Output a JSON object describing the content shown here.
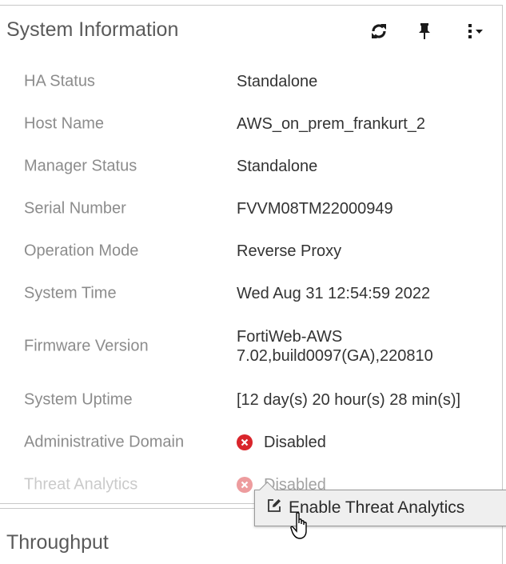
{
  "system_info": {
    "title": "System Information",
    "header_icons": [
      "refresh-icon",
      "pin-icon",
      "more-menu-icon"
    ],
    "rows": [
      {
        "label": "HA Status",
        "value": "Standalone"
      },
      {
        "label": "Host Name",
        "value": "AWS_on_prem_frankurt_2"
      },
      {
        "label": "Manager Status",
        "value": "Standalone"
      },
      {
        "label": "Serial Number",
        "value": "FVVM08TM22000949"
      },
      {
        "label": "Operation Mode",
        "value": "Reverse Proxy"
      },
      {
        "label": "System Time",
        "value": "Wed Aug 31 12:54:59 2022"
      },
      {
        "label": "Firmware Version",
        "value_line1": "FortiWeb-AWS",
        "value_line2": "7.02,build0097(GA),220810"
      },
      {
        "label": "System Uptime",
        "value": "[12 day(s) 20 hour(s) 28 min(s)]"
      },
      {
        "label": "Administrative Domain",
        "value": "Disabled",
        "icon": "disabled-x-icon",
        "icon_color": "#d9252b"
      },
      {
        "label": "Threat Analytics",
        "value": "Disabled",
        "icon": "disabled-x-icon",
        "icon_color": "#d9252b"
      }
    ]
  },
  "tooltip": {
    "label": "Enable Threat Analytics",
    "icon": "edit-icon"
  },
  "throughput": {
    "title": "Throughput"
  }
}
